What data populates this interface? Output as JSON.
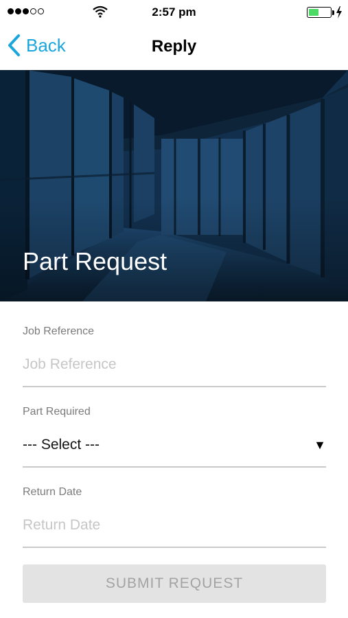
{
  "status_bar": {
    "signal_dots_filled": 3,
    "signal_dots_total": 5,
    "time": "2:57 pm",
    "battery_level": 0.45,
    "battery_color": "#4cd964",
    "icons": [
      "wifi-icon",
      "battery-icon",
      "charging-bolt-icon"
    ]
  },
  "nav": {
    "back_label": "Back",
    "title": "Reply",
    "accent_color": "#1aa6dc"
  },
  "hero": {
    "title": "Part Request"
  },
  "form": {
    "job_reference": {
      "label": "Job Reference",
      "placeholder": "Job Reference",
      "value": ""
    },
    "part_required": {
      "label": "Part Required",
      "selected": "--- Select ---"
    },
    "return_date": {
      "label": "Return Date",
      "placeholder": "Return Date",
      "value": ""
    },
    "submit_label": "SUBMIT REQUEST"
  }
}
